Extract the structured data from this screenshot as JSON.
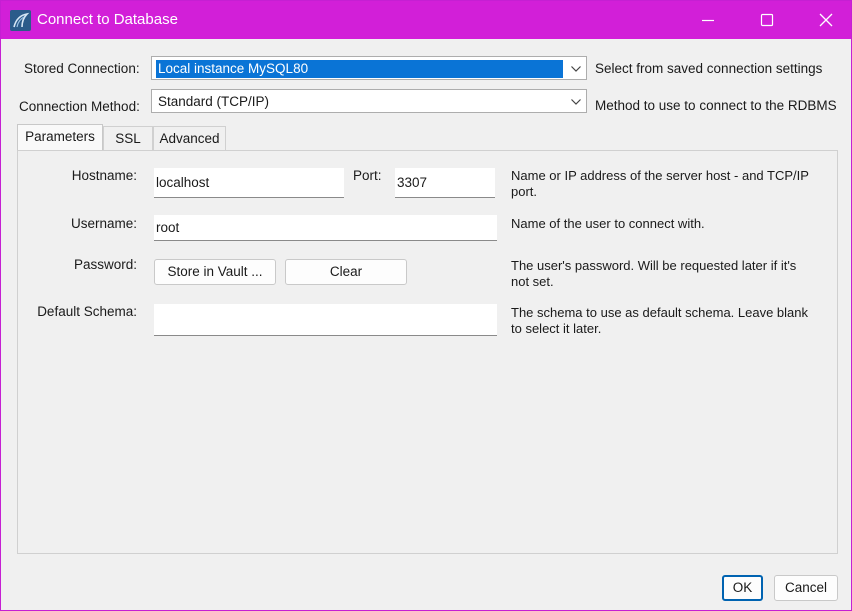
{
  "window": {
    "title": "Connect to Database",
    "accent_color": "#d21fd8",
    "icons": [
      "mysql-workbench-dolphin-icon",
      "minimize-icon",
      "maximize-icon",
      "close-icon"
    ]
  },
  "stored_connection": {
    "label": "Stored Connection:",
    "value": "Local instance MySQL80",
    "description": "Select from saved connection settings"
  },
  "connection_method": {
    "label": "Connection Method:",
    "value": "Standard (TCP/IP)",
    "description": "Method to use to connect to the RDBMS"
  },
  "tabs": [
    {
      "label": "Parameters",
      "active": true
    },
    {
      "label": "SSL",
      "active": false
    },
    {
      "label": "Advanced",
      "active": false
    }
  ],
  "parameters": {
    "hostname": {
      "label": "Hostname:",
      "value": "localhost"
    },
    "port": {
      "label": "Port:",
      "value": "3307"
    },
    "hostname_desc": "Name or IP address of the server host - and TCP/IP port.",
    "username": {
      "label": "Username:",
      "value": "root",
      "description": "Name of the user to connect with."
    },
    "password": {
      "label": "Password:",
      "store_button": "Store in Vault ...",
      "clear_button": "Clear",
      "description": "The user's password. Will be requested later if it's not set."
    },
    "default_schema": {
      "label": "Default Schema:",
      "value": "",
      "description": "The schema to use as default schema. Leave blank to select it later."
    }
  },
  "footer": {
    "ok_label": "OK",
    "cancel_label": "Cancel"
  }
}
